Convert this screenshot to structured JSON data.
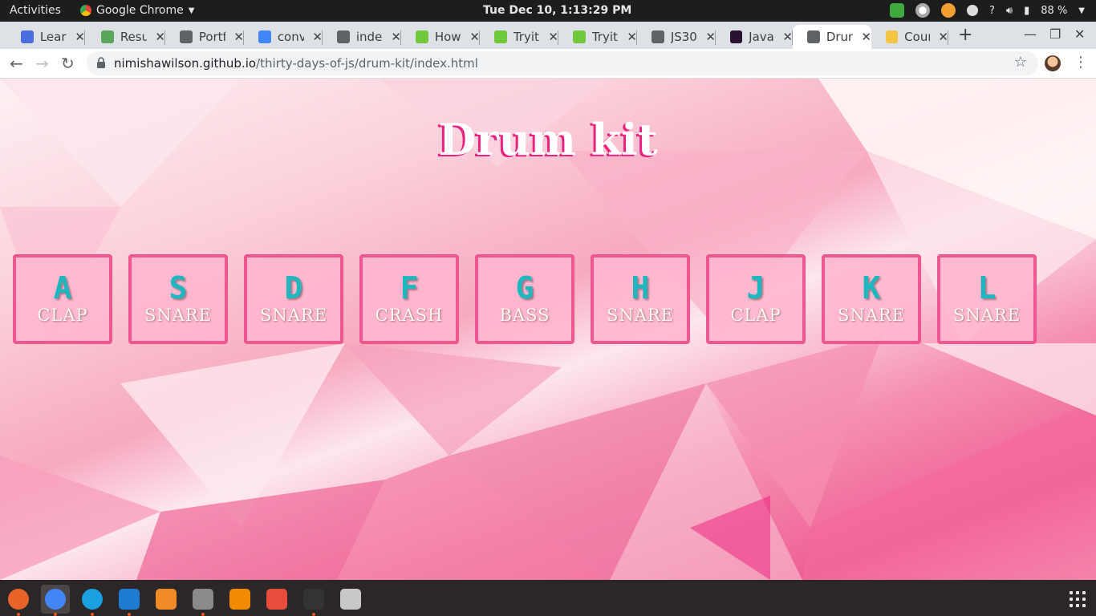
{
  "system_bar": {
    "activities": "Activities",
    "app_name": "Google Chrome",
    "clock": "Tue Dec 10,  1:13:29 PM",
    "battery": "88 %"
  },
  "tabs": [
    {
      "title": "Learn",
      "icon": "docs-icon",
      "color": "#4a6ee0"
    },
    {
      "title": "Resu",
      "icon": "trello-icon",
      "color": "#5aa65a"
    },
    {
      "title": "Portf",
      "icon": "globe-icon",
      "color": "#5f6368"
    },
    {
      "title": "conve",
      "icon": "google-icon",
      "color": "#4285f4"
    },
    {
      "title": "index",
      "icon": "globe-icon",
      "color": "#5f6368"
    },
    {
      "title": "How",
      "icon": "w3schools-icon",
      "color": "#6fc83a"
    },
    {
      "title": "Tryit",
      "icon": "w3schools-icon",
      "color": "#6fc83a"
    },
    {
      "title": "Tryit",
      "icon": "w3schools-icon",
      "color": "#6fc83a"
    },
    {
      "title": "JS30",
      "icon": "globe-icon",
      "color": "#5f6368"
    },
    {
      "title": "Java",
      "icon": "js30-icon",
      "color": "#2b1230"
    },
    {
      "title": "Drun",
      "icon": "globe-icon",
      "color": "#5f6368",
      "active": true
    },
    {
      "title": "Cour",
      "icon": "crown-icon",
      "color": "#f4c542"
    }
  ],
  "address_bar": {
    "host": "nimishawilson.github.io",
    "path": "/thirty-days-of-js/drum-kit/index.html"
  },
  "page": {
    "title": "Drum kit",
    "keys": [
      {
        "key": "A",
        "sound": "CLAP"
      },
      {
        "key": "S",
        "sound": "SNARE"
      },
      {
        "key": "D",
        "sound": "SNARE"
      },
      {
        "key": "F",
        "sound": "CRASH"
      },
      {
        "key": "G",
        "sound": "BASS"
      },
      {
        "key": "H",
        "sound": "SNARE"
      },
      {
        "key": "J",
        "sound": "CLAP"
      },
      {
        "key": "K",
        "sound": "SNARE"
      },
      {
        "key": "L",
        "sound": "SNARE"
      }
    ]
  },
  "dock": [
    {
      "name": "firefox",
      "color": "#e8642a"
    },
    {
      "name": "chrome",
      "color": "#4285f4",
      "active": true
    },
    {
      "name": "skype",
      "color": "#1a9fe0"
    },
    {
      "name": "vscode",
      "color": "#1e7bd2"
    },
    {
      "name": "blender",
      "color": "#f08a24"
    },
    {
      "name": "files",
      "color": "#8a8a8a"
    },
    {
      "name": "vlc",
      "color": "#f08a00"
    },
    {
      "name": "git",
      "color": "#e74c3c"
    },
    {
      "name": "terminal",
      "color": "#333333"
    },
    {
      "name": "settings",
      "color": "#c8c8c8"
    }
  ]
}
